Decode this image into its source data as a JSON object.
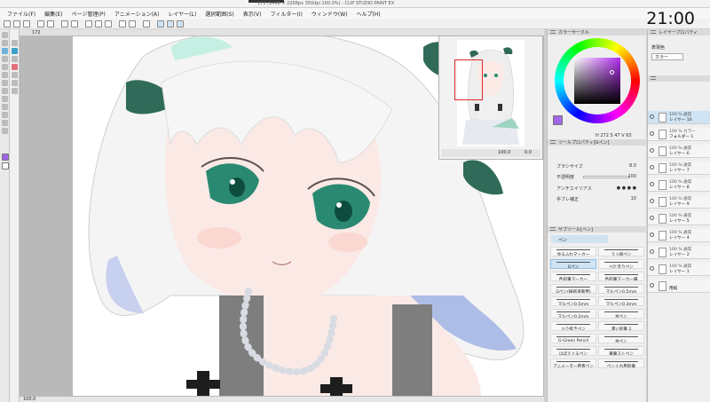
{
  "window": {
    "title": "172 (1496 × 2208px 350dpi 100.0%) - CLIP STUDIO PAINT EX"
  },
  "menu": {
    "items": [
      "ファイル(F)",
      "編集(E)",
      "ページ管理(P)",
      "アニメーション(A)",
      "レイヤー(L)",
      "選択範囲(S)",
      "表示(V)",
      "フィルター(I)",
      "ウィンドウ(W)",
      "ヘルプ(H)"
    ]
  },
  "clock": "21:00",
  "canvas": {
    "tab_label": "172",
    "zoom_status": "100.0"
  },
  "navigator": {
    "zoom": "100.0",
    "angle": "0.0"
  },
  "color_panel": {
    "title": "カラーサークル",
    "main_color": "#a366e6",
    "values": "H 272  S 47  V 63"
  },
  "tool_property": {
    "title": "ツールプロパティ[Gペン]",
    "rows": [
      {
        "label": "ブラシサイズ",
        "value": "8.0"
      },
      {
        "label": "不透明度",
        "value": "100"
      },
      {
        "label": "アンチエイリアス",
        "value": ""
      },
      {
        "label": "手ブレ補正",
        "value": "10"
      }
    ]
  },
  "subtool": {
    "title": "サブツール[ペン]",
    "group_label": "ペン",
    "brushes": [
      "ゆるふわマーカー",
      "うっ吸ペン",
      "Gペン",
      "べた塗りペン",
      "色鉛筆マーカー",
      "色鉛筆マーカー細",
      "Gペン(線画清書用)",
      "マルペン0.5mm",
      "マルペン0.5mm",
      "マルペン0.3mm",
      "マルペン0.2mm",
      "Mペン",
      "入り抜きペン",
      "濃い鉛筆 2",
      "G-Green Pencil",
      "Mペン",
      "ほぼえぐるペン",
      "筆筆ストペン",
      "アニメーター用青ペン",
      "ペン入れ用鉛筆"
    ]
  },
  "layer_panel": {
    "title": "レイヤープロパティ",
    "expression": "表現色",
    "expression_value": "カラー",
    "layers": [
      {
        "mode": "100 % 通常",
        "name": "レイヤー 10"
      },
      {
        "mode": "100 % カラー",
        "name": "フォルダー 1"
      },
      {
        "mode": "100 % 通常",
        "name": "レイヤー 6"
      },
      {
        "mode": "100 % 通常",
        "name": "レイヤー 7"
      },
      {
        "mode": "100 % 通常",
        "name": "レイヤー 8"
      },
      {
        "mode": "100 % 通常",
        "name": "レイヤー 9"
      },
      {
        "mode": "100 % 通常",
        "name": "レイヤー 5"
      },
      {
        "mode": "100 % 通常",
        "name": "レイヤー 4"
      },
      {
        "mode": "100 % 通常",
        "name": "レイヤー 2"
      },
      {
        "mode": "100 % 通常",
        "name": "レイヤー 1"
      },
      {
        "mode": "",
        "name": "用紙"
      }
    ]
  }
}
